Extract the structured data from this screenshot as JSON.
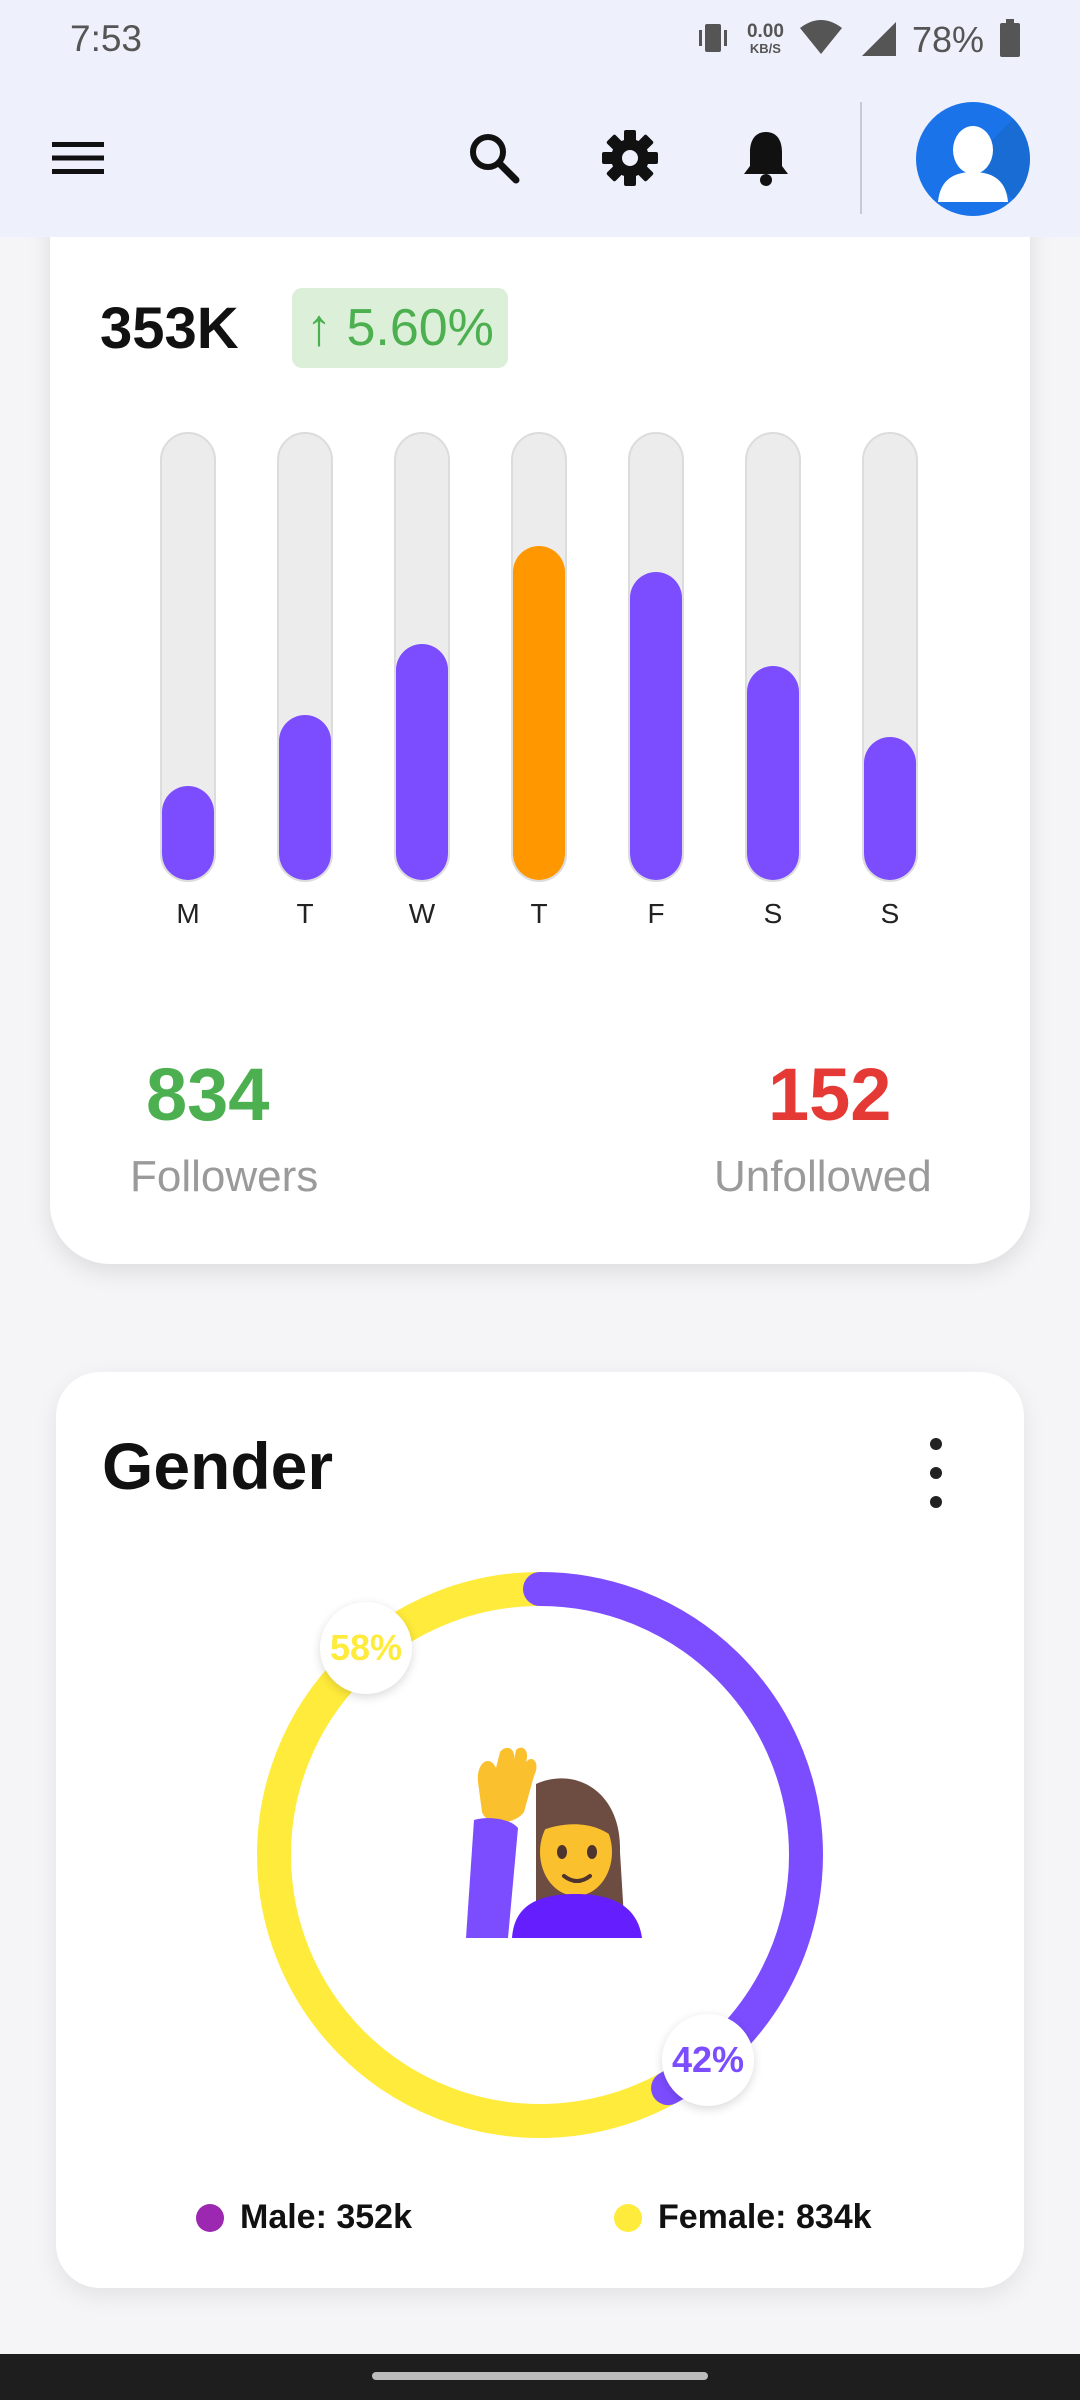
{
  "status_bar": {
    "time": "7:53",
    "net_speed_value": "0.00",
    "net_speed_unit": "KB/S",
    "battery": "78%",
    "icons": [
      "vibrate-icon",
      "wifi-icon",
      "signal-icon",
      "battery-icon"
    ]
  },
  "app_bar": {
    "icons": [
      "menu-icon",
      "search-icon",
      "settings-icon",
      "bell-icon"
    ],
    "avatar_icon": "user-avatar-icon",
    "background": "#eef0fc"
  },
  "weekly_card": {
    "total": "353K",
    "change": "↑ 5.60%",
    "change_color": "#4caf50",
    "followers_value": "834",
    "followers_label": "Followers",
    "followers_color": "#4caf50",
    "unfollowed_value": "152",
    "unfollowed_label": "Unfollowed",
    "unfollowed_color": "#e53935"
  },
  "chart_data": {
    "type": "bar",
    "categories": [
      "M",
      "T",
      "W",
      "T",
      "F",
      "S",
      "S"
    ],
    "values": [
      21,
      37,
      53,
      75,
      69,
      48,
      32
    ],
    "ylim": [
      0,
      100
    ],
    "highlight_index": 3,
    "colors": {
      "default": "#7c4dff",
      "highlight": "#ff9800",
      "track": "#ececec"
    }
  },
  "gender_card": {
    "title": "Gender",
    "more_icon": "more-vertical-icon",
    "female_pct": "58%",
    "male_pct": "42%",
    "female_fraction": 0.58,
    "male_fraction": 0.42,
    "female_color": "#ffeb3b",
    "male_color": "#7c4dff",
    "center_icon": "woman-raising-hand-emoji",
    "legend": [
      {
        "label": "Male: 352k",
        "color": "#9c27b0"
      },
      {
        "label": "Female: 834k",
        "color": "#ffeb3b"
      }
    ]
  }
}
